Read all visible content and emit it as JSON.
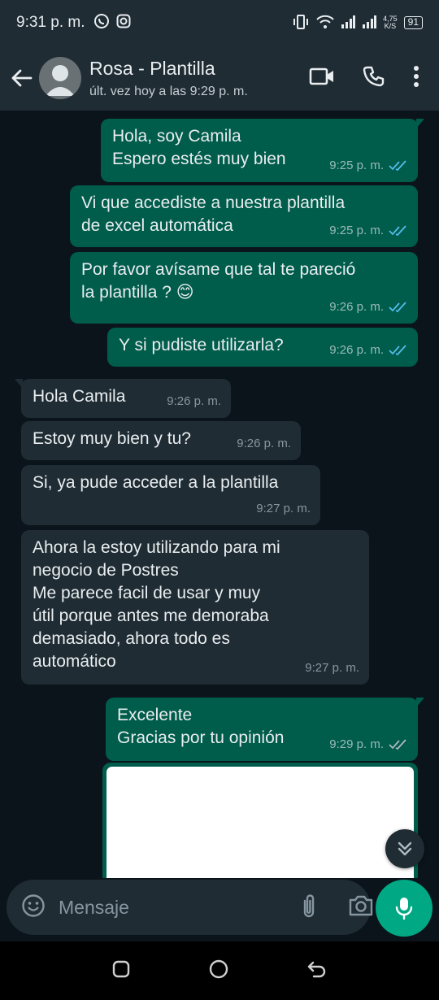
{
  "status_bar": {
    "time": "9:31 p. m.",
    "speed_value": "4,75",
    "speed_unit": "K/S",
    "battery": "91"
  },
  "header": {
    "contact_name": "Rosa - Plantilla",
    "last_seen": "últ. vez hoy a las 9:29 p. m."
  },
  "messages": [
    {
      "direction": "out",
      "text": "Hola, soy Camila\nEspero estés muy bien",
      "time": "9:25 p. m.",
      "status": "read"
    },
    {
      "direction": "out",
      "text": "Vi que accediste a nuestra plantilla\nde excel automática",
      "time": "9:25 p. m.",
      "status": "read"
    },
    {
      "direction": "out",
      "text": "Por favor avísame que tal te pareció\nla plantilla ? 😊",
      "time": "9:26 p. m.",
      "status": "read"
    },
    {
      "direction": "out",
      "text": "Y si pudiste utilizarla?",
      "time": "9:26 p. m.",
      "status": "read"
    },
    {
      "direction": "in",
      "text": "Hola Camila",
      "time": "9:26 p. m."
    },
    {
      "direction": "in",
      "text": "Estoy muy bien y tu?",
      "time": "9:26 p. m."
    },
    {
      "direction": "in",
      "text": "Si, ya pude acceder a la plantilla",
      "time": "9:27 p. m."
    },
    {
      "direction": "in",
      "text": "Ahora la estoy utilizando para mi\nnegocio de Postres\nMe parece facil de usar y muy\nútil porque antes me demoraba\ndemasiado, ahora todo es\nautomático",
      "time": "9:27 p. m."
    },
    {
      "direction": "out",
      "text": "Excelente\nGracias por tu opinión",
      "time": "9:29 p. m.",
      "status": "delivered"
    }
  ],
  "input": {
    "placeholder": "Mensaje"
  },
  "colors": {
    "outgoing_bubble": "#005c4b",
    "incoming_bubble": "#1f2c34",
    "read_ticks": "#53bdeb",
    "accent": "#00a884",
    "background": "#0b141a"
  }
}
